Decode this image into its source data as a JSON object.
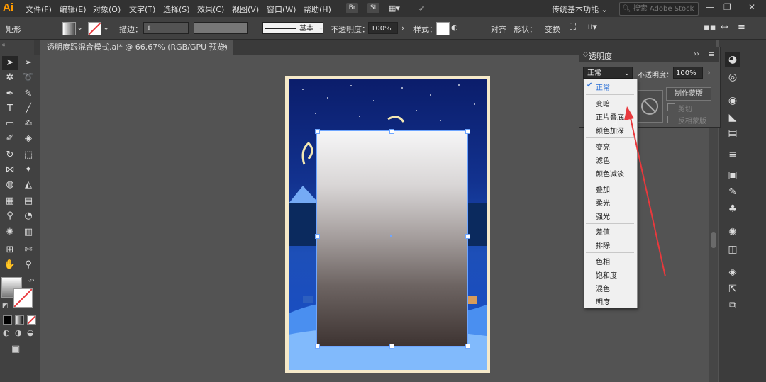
{
  "app": {
    "logo": "Ai"
  },
  "menubar": {
    "items": [
      "文件(F)",
      "编辑(E)",
      "对象(O)",
      "文字(T)",
      "选择(S)",
      "效果(C)",
      "视图(V)",
      "窗口(W)",
      "帮助(H)"
    ],
    "bridge_label": "Br",
    "stock_label": "St",
    "workspace": "传统基本功能",
    "search_placeholder": "搜索 Adobe Stock",
    "minimize": "—",
    "restore": "❐",
    "close": "✕"
  },
  "control_bar": {
    "object_type": "矩形",
    "stroke_label": "描边：",
    "basic_label": "基本",
    "opacity_label": "不透明度：",
    "opacity_value": "100%",
    "style_label": "样式：",
    "align_label": "对齐",
    "shape_label": "形状：",
    "transform_label": "变换"
  },
  "document": {
    "tab_title": "透明度跟混合模式.ai* @ 66.67% (RGB/GPU 预览)",
    "tab_close": "✕"
  },
  "transparency_panel": {
    "title": "透明度",
    "current_mode": "正常",
    "opacity_label": "不透明度：",
    "opacity_value": "100%",
    "make_mask_label": "制作蒙版",
    "clip_label": "剪切",
    "invert_label": "反相蒙版"
  },
  "blend_modes": {
    "selected": "正常",
    "groups": [
      [
        "正常"
      ],
      [
        "变暗",
        "正片叠底",
        "颜色加深"
      ],
      [
        "变亮",
        "滤色",
        "颜色减淡"
      ],
      [
        "叠加",
        "柔光",
        "强光"
      ],
      [
        "差值",
        "排除"
      ],
      [
        "色相",
        "饱和度",
        "混色",
        "明度"
      ]
    ]
  },
  "colors": {
    "accent": "#6fa6ff",
    "annotation_arrow": "#e8393d",
    "selected_mode": "#2a6fd6"
  },
  "icons": [
    "selection-icon",
    "direct-selection-icon",
    "magic-wand-icon",
    "lasso-icon",
    "pen-icon",
    "curvature-icon",
    "type-icon",
    "line-icon",
    "rectangle-icon",
    "brush-icon",
    "shaper-icon",
    "eraser-icon",
    "rotate-icon",
    "scale-icon",
    "width-icon",
    "puppet-warp-icon",
    "shape-builder-icon",
    "perspective-icon",
    "mesh-icon",
    "gradient-icon",
    "eyedropper-icon",
    "blend-icon",
    "symbol-sprayer-icon",
    "graph-icon",
    "artboard-icon",
    "slice-icon",
    "hand-icon",
    "zoom-icon"
  ]
}
